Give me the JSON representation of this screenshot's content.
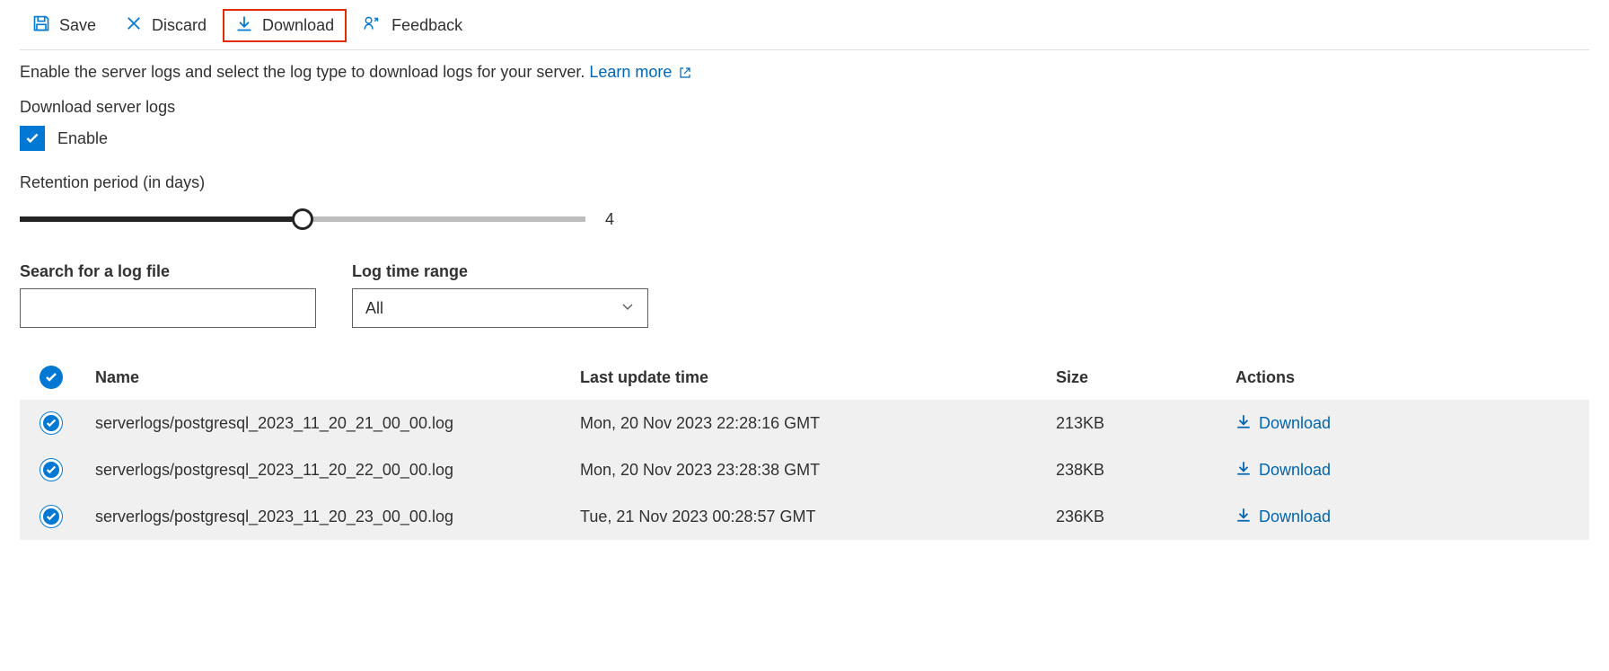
{
  "toolbar": {
    "save": "Save",
    "discard": "Discard",
    "download": "Download",
    "feedback": "Feedback"
  },
  "description": {
    "text": "Enable the server logs and select the log type to download logs for your server.",
    "link": "Learn more"
  },
  "downloadLogs": {
    "title": "Download server logs",
    "enableLabel": "Enable"
  },
  "retention": {
    "label": "Retention period (in days)",
    "value": "4"
  },
  "search": {
    "label": "Search for a log file"
  },
  "timeRange": {
    "label": "Log time range",
    "selected": "All"
  },
  "columns": {
    "name": "Name",
    "time": "Last update time",
    "size": "Size",
    "actions": "Actions"
  },
  "downloadAction": "Download",
  "rows": [
    {
      "name": "serverlogs/postgresql_2023_11_20_21_00_00.log",
      "time": "Mon, 20 Nov 2023 22:28:16 GMT",
      "size": "213KB"
    },
    {
      "name": "serverlogs/postgresql_2023_11_20_22_00_00.log",
      "time": "Mon, 20 Nov 2023 23:28:38 GMT",
      "size": "238KB"
    },
    {
      "name": "serverlogs/postgresql_2023_11_20_23_00_00.log",
      "time": "Tue, 21 Nov 2023 00:28:57 GMT",
      "size": "236KB"
    }
  ]
}
